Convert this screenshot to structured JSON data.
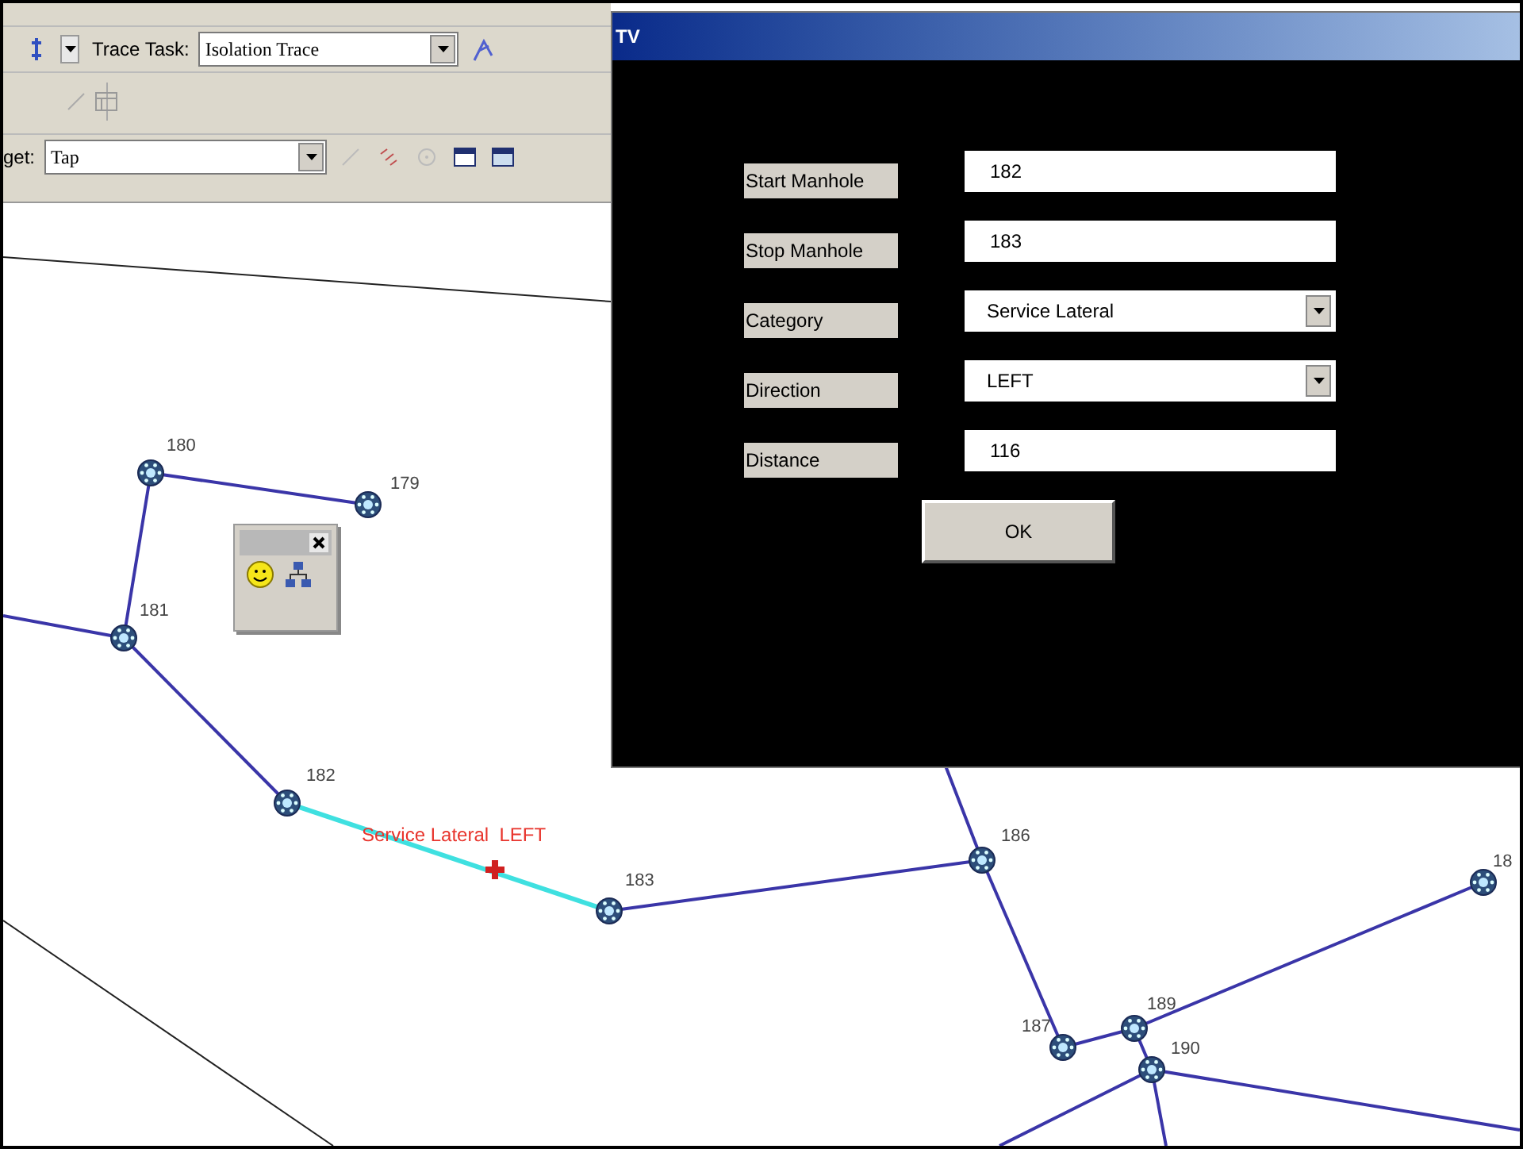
{
  "toolbar": {
    "trace_task_label": "Trace Task:",
    "trace_task_value": "Isolation Trace",
    "target_label": "get:",
    "target_value": "Tap"
  },
  "dialog": {
    "title": "TV",
    "fields": [
      {
        "label": "Start Manhole",
        "value": "182",
        "kind": "text"
      },
      {
        "label": "Stop Manhole",
        "value": "183",
        "kind": "text"
      },
      {
        "label": "Category",
        "value": "Service Lateral",
        "kind": "dropdown"
      },
      {
        "label": "Direction",
        "value": "LEFT",
        "kind": "dropdown"
      },
      {
        "label": "Distance",
        "value": "116",
        "kind": "text"
      }
    ],
    "ok_button": "OK"
  },
  "map": {
    "nodes": [
      {
        "label": "180"
      },
      {
        "label": "179"
      },
      {
        "label": "181"
      },
      {
        "label": "182"
      },
      {
        "label": "183"
      },
      {
        "label": "186"
      },
      {
        "label": "187"
      },
      {
        "label": "189"
      },
      {
        "label": "190"
      },
      {
        "label": "18"
      }
    ],
    "annotation": "Service Lateral  LEFT"
  }
}
